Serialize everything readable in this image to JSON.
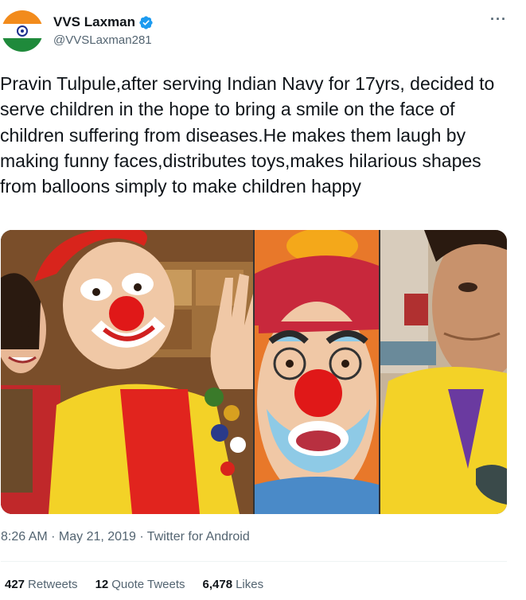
{
  "tweet": {
    "author": {
      "name": "VVS Laxman",
      "handle": "@VVSLaxman281",
      "verified": true,
      "avatar": "india-flag-avatar"
    },
    "more_icon": "more-horizontal-icon",
    "text": "Pravin Tulpule,after serving Indian Navy for 17yrs, decided to serve children in the hope to bring a smile on the face of children suffering from diseases.He makes them laugh by making funny faces,distributes toys,makes hilarious shapes from balloons simply to make children happy",
    "media": [
      "photo-clown-with-girl",
      "photo-clown-closeup",
      "photo-man-yellow-shirt"
    ],
    "timestamp": "8:26 AM · May 21, 2019 · Twitter for Android",
    "stats": {
      "retweets_count": "427",
      "retweets_label": "Retweets",
      "quotes_count": "12",
      "quotes_label": "Quote Tweets",
      "likes_count": "6,478",
      "likes_label": "Likes"
    }
  },
  "colors": {
    "text": "#0f1419",
    "secondary": "#536471",
    "verified_blue": "#1d9bf0",
    "divider": "#eff3f4"
  }
}
